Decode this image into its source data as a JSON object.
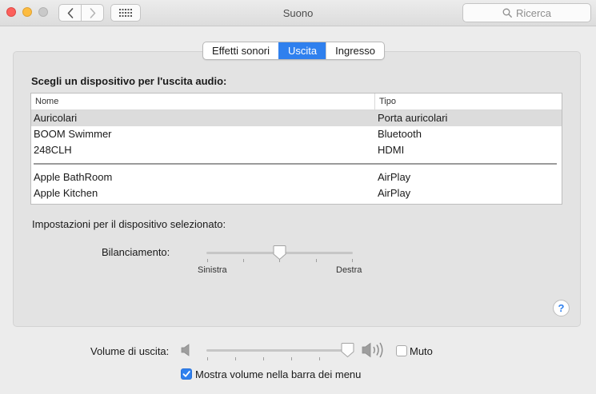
{
  "window": {
    "title": "Suono",
    "search_placeholder": "Ricerca"
  },
  "tabs": [
    {
      "label": "Effetti sonori",
      "active": false
    },
    {
      "label": "Uscita",
      "active": true
    },
    {
      "label": "Ingresso",
      "active": false
    }
  ],
  "output": {
    "section_title": "Scegli un dispositivo per l'uscita audio:",
    "columns": [
      "Nome",
      "Tipo"
    ],
    "devices_group1": [
      {
        "name": "Auricolari",
        "type": "Porta auricolari",
        "selected": true
      },
      {
        "name": "BOOM Swimmer",
        "type": "Bluetooth",
        "selected": false
      },
      {
        "name": "248CLH",
        "type": "HDMI",
        "selected": false
      }
    ],
    "devices_group2": [
      {
        "name": "Apple BathRoom",
        "type": "AirPlay",
        "selected": false
      },
      {
        "name": "Apple Kitchen",
        "type": "AirPlay",
        "selected": false
      }
    ],
    "settings_label": "Impostazioni per il dispositivo selezionato:",
    "balance_label": "Bilanciamento:",
    "balance_left": "Sinistra",
    "balance_right": "Destra",
    "balance_value": 0.5,
    "help_label": "?"
  },
  "volume": {
    "label": "Volume di uscita:",
    "value": 0.96,
    "mute_label": "Muto",
    "mute_checked": false,
    "show_in_menu_label": "Mostra volume nella barra dei menu",
    "show_in_menu_checked": true
  },
  "icons": {
    "back": "chevron-left-icon",
    "forward": "chevron-right-icon",
    "grid": "grid-icon",
    "search": "magnifier-icon",
    "speaker_low": "speaker-low-icon",
    "speaker_high": "speaker-high-icon",
    "help": "help-icon"
  },
  "colors": {
    "accent": "#2f80ee",
    "selection": "#dcdcdc"
  }
}
